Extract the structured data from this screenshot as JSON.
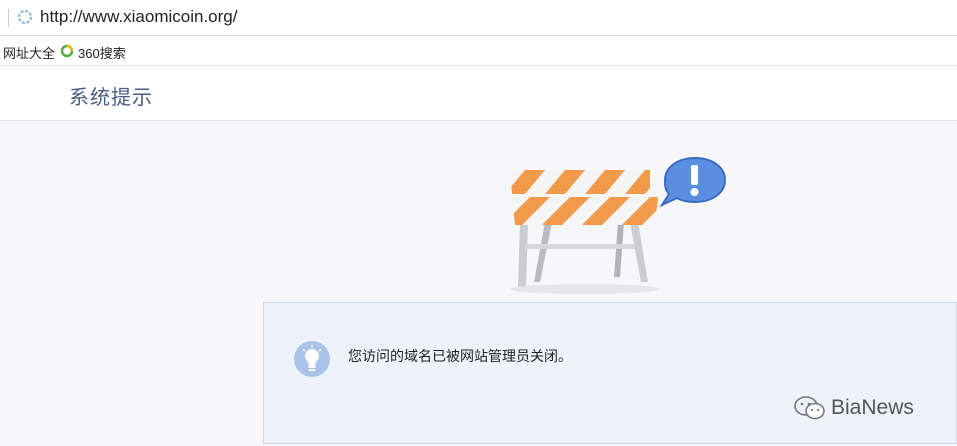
{
  "browser": {
    "url": "http://www.xiaomicoin.org/",
    "bookmarks": [
      {
        "label": "网址大全"
      },
      {
        "label": "360搜索"
      }
    ]
  },
  "page": {
    "title": "系统提示",
    "message": "您访问的域名已被网站管理员关闭。"
  },
  "watermark": {
    "text": "BiaNews"
  },
  "colors": {
    "title": "#4a5e82",
    "message_bg": "#eef2fb",
    "barrier_stripe": "#f39a4a",
    "speech_bubble": "#5a8ee0"
  }
}
